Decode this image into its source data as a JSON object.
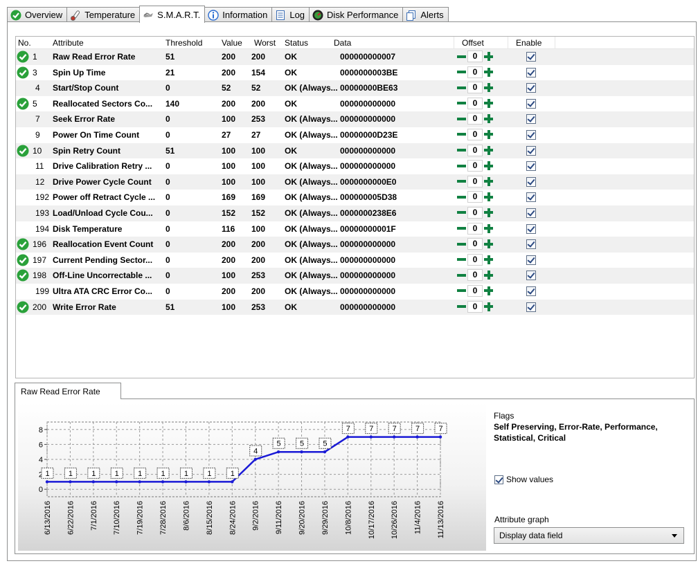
{
  "tabs": [
    {
      "label": "Overview",
      "icon": "green-check-icon"
    },
    {
      "label": "Temperature",
      "icon": "thermometer-icon"
    },
    {
      "label": "S.M.A.R.T.",
      "icon": "smart-icon",
      "active": true
    },
    {
      "label": "Information",
      "icon": "info-icon"
    },
    {
      "label": "Log",
      "icon": "log-icon"
    },
    {
      "label": "Disk Performance",
      "icon": "gauge-icon"
    },
    {
      "label": "Alerts",
      "icon": "alerts-icon"
    }
  ],
  "columns": {
    "no": "No.",
    "attribute": "Attribute",
    "threshold": "Threshold",
    "value": "Value",
    "worst": "Worst",
    "status": "Status",
    "data": "Data",
    "offset": "Offset",
    "enable": "Enable"
  },
  "rows": [
    {
      "ok": true,
      "no": "1",
      "attribute": "Raw Read Error Rate",
      "threshold": "51",
      "value": "200",
      "worst": "200",
      "status": "OK",
      "data": "000000000007",
      "offset": "0"
    },
    {
      "ok": true,
      "no": "3",
      "attribute": "Spin Up Time",
      "threshold": "21",
      "value": "200",
      "worst": "154",
      "status": "OK",
      "data": "0000000003BE",
      "offset": "0"
    },
    {
      "ok": false,
      "no": "4",
      "attribute": "Start/Stop Count",
      "threshold": "0",
      "value": "52",
      "worst": "52",
      "status": "OK (Always...",
      "data": "00000000BE63",
      "offset": "0"
    },
    {
      "ok": true,
      "no": "5",
      "attribute": "Reallocated Sectors Co...",
      "threshold": "140",
      "value": "200",
      "worst": "200",
      "status": "OK",
      "data": "000000000000",
      "offset": "0"
    },
    {
      "ok": false,
      "no": "7",
      "attribute": "Seek Error Rate",
      "threshold": "0",
      "value": "100",
      "worst": "253",
      "status": "OK (Always...",
      "data": "000000000000",
      "offset": "0"
    },
    {
      "ok": false,
      "no": "9",
      "attribute": "Power On Time Count",
      "threshold": "0",
      "value": "27",
      "worst": "27",
      "status": "OK (Always...",
      "data": "00000000D23E",
      "offset": "0"
    },
    {
      "ok": true,
      "no": "10",
      "attribute": "Spin Retry Count",
      "threshold": "51",
      "value": "100",
      "worst": "100",
      "status": "OK",
      "data": "000000000000",
      "offset": "0"
    },
    {
      "ok": false,
      "no": "11",
      "attribute": "Drive Calibration Retry ...",
      "threshold": "0",
      "value": "100",
      "worst": "100",
      "status": "OK (Always...",
      "data": "000000000000",
      "offset": "0"
    },
    {
      "ok": false,
      "no": "12",
      "attribute": "Drive Power Cycle Count",
      "threshold": "0",
      "value": "100",
      "worst": "100",
      "status": "OK (Always...",
      "data": "0000000000E0",
      "offset": "0"
    },
    {
      "ok": false,
      "no": "192",
      "attribute": "Power off Retract Cycle ...",
      "threshold": "0",
      "value": "169",
      "worst": "169",
      "status": "OK (Always...",
      "data": "000000005D38",
      "offset": "0"
    },
    {
      "ok": false,
      "no": "193",
      "attribute": "Load/Unload Cycle Cou...",
      "threshold": "0",
      "value": "152",
      "worst": "152",
      "status": "OK (Always...",
      "data": "0000000238E6",
      "offset": "0"
    },
    {
      "ok": false,
      "no": "194",
      "attribute": "Disk Temperature",
      "threshold": "0",
      "value": "116",
      "worst": "100",
      "status": "OK (Always...",
      "data": "00000000001F",
      "offset": "0"
    },
    {
      "ok": true,
      "no": "196",
      "attribute": "Reallocation Event Count",
      "threshold": "0",
      "value": "200",
      "worst": "200",
      "status": "OK (Always...",
      "data": "000000000000",
      "offset": "0"
    },
    {
      "ok": true,
      "no": "197",
      "attribute": "Current Pending Sector...",
      "threshold": "0",
      "value": "200",
      "worst": "200",
      "status": "OK (Always...",
      "data": "000000000000",
      "offset": "0"
    },
    {
      "ok": true,
      "no": "198",
      "attribute": "Off-Line Uncorrectable ...",
      "threshold": "0",
      "value": "100",
      "worst": "253",
      "status": "OK (Always...",
      "data": "000000000000",
      "offset": "0"
    },
    {
      "ok": false,
      "no": "199",
      "attribute": "Ultra ATA CRC Error Co...",
      "threshold": "0",
      "value": "200",
      "worst": "200",
      "status": "OK (Always...",
      "data": "000000000000",
      "offset": "0"
    },
    {
      "ok": true,
      "no": "200",
      "attribute": "Write Error Rate",
      "threshold": "51",
      "value": "100",
      "worst": "253",
      "status": "OK",
      "data": "000000000000",
      "offset": "0"
    }
  ],
  "bottom_tab": "Raw Read Error Rate",
  "flags": {
    "title": "Flags",
    "value": "Self Preserving, Error-Rate, Performance, Statistical, Critical"
  },
  "show_values": {
    "label": "Show values",
    "checked": true
  },
  "attribute_graph": {
    "label": "Attribute graph",
    "selected": "Display data field"
  },
  "colors": {
    "ok_green": "#2aa13a",
    "line_blue": "#1a1ad6",
    "offset_green": "#118142"
  },
  "chart_data": {
    "type": "line",
    "x": [
      "6/13/2016",
      "6/22/2016",
      "7/1/2016",
      "7/10/2016",
      "7/19/2016",
      "7/28/2016",
      "8/6/2016",
      "8/15/2016",
      "8/24/2016",
      "9/2/2016",
      "9/11/2016",
      "9/20/2016",
      "9/29/2016",
      "10/8/2016",
      "10/17/2016",
      "10/26/2016",
      "11/4/2016",
      "11/13/2016"
    ],
    "series": [
      {
        "values": [
          1,
          1,
          1,
          1,
          1,
          1,
          1,
          1,
          1,
          4,
          5,
          5,
          5,
          7,
          7,
          7,
          7,
          7
        ]
      }
    ],
    "yticks": [
      0,
      2,
      4,
      6,
      8
    ],
    "ylim": [
      -1,
      9
    ],
    "grid": true,
    "title": "",
    "xlabel": "",
    "ylabel": ""
  }
}
